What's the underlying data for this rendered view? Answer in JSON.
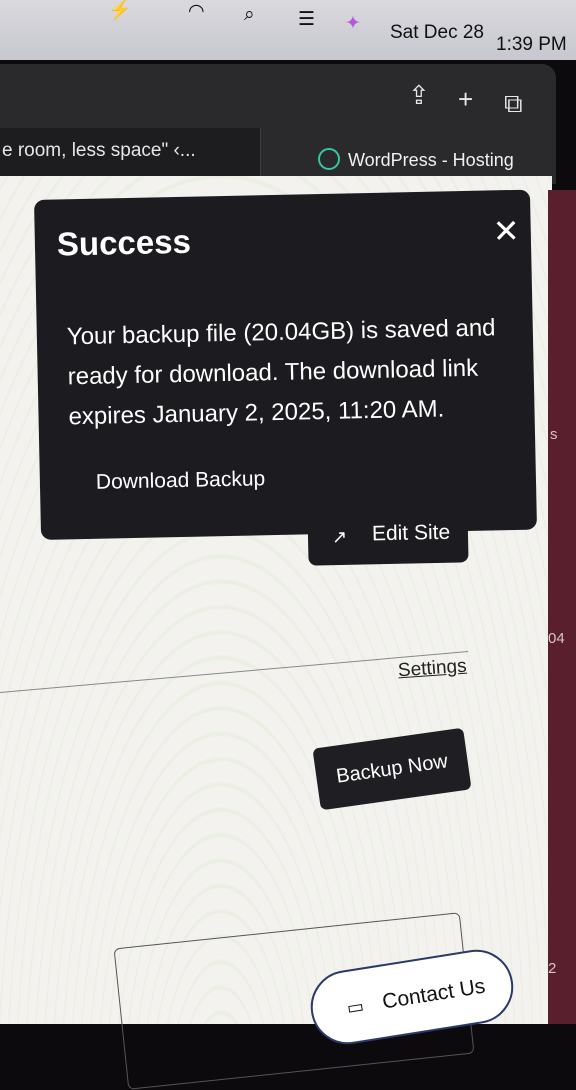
{
  "menubar": {
    "date": "Sat Dec 28",
    "time": "1:39 PM",
    "icons": [
      "battery-charging-icon",
      "wifi-icon",
      "search-icon",
      "control-center-icon",
      "siri-icon"
    ]
  },
  "browser": {
    "tabs": [
      {
        "label": "e room, less space\" ‹..."
      },
      {
        "label": "WordPress - Hosting",
        "icon": "wordpress-hosting-logo-icon"
      }
    ],
    "toolbar_icons": [
      "share-icon",
      "new-tab-icon",
      "tab-overview-icon"
    ]
  },
  "toast": {
    "title": "Success",
    "message": "Your backup file (20.04GB) is saved and ready for download. The download link expires January 2, 2025, 11:20 AM.",
    "link": "Download Backup",
    "close_icon": "close-icon"
  },
  "edit_site": {
    "label": "Edit Site",
    "icon": "external-link-icon"
  },
  "settings": {
    "label": "Settings"
  },
  "backup_now": {
    "label": "Backup Now"
  },
  "contact": {
    "label": "Contact Us",
    "icon": "chat-icon"
  },
  "right_strip": {
    "texts": [
      "s",
      "04",
      "2"
    ]
  }
}
